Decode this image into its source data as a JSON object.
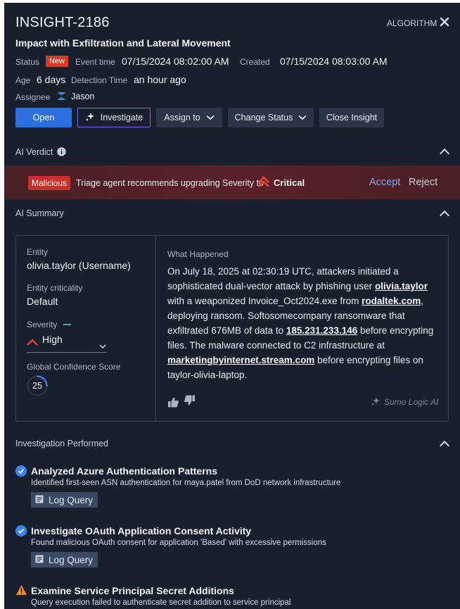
{
  "insight": {
    "id": "INSIGHT-2186",
    "source": "ALGORITHM",
    "title": "Impact with Exfiltration and Lateral Movement"
  },
  "meta": {
    "status_label": "Status",
    "status_value": "New",
    "event_time_label": "Event time",
    "event_time_value": "07/15/2024 08:02:00 AM",
    "created_label": "Created",
    "created_value": "07/15/2024 08:03:00 AM",
    "age_label": "Age",
    "age_value": "6 days",
    "detection_label": "Detection Time",
    "detection_value": "an hour ago",
    "assignee_label": "Assignee",
    "assignee_value": "Jason"
  },
  "actions": {
    "open": "Open",
    "investigate": "Investigate",
    "assign": "Assign to",
    "change_status": "Change Status",
    "close": "Close Insight"
  },
  "verdict": {
    "header": "AI Verdict",
    "badge": "Malicious",
    "text": "Triage agent recommends upgrading Severity to",
    "severity": "Critical",
    "accept": "Accept",
    "reject": "Reject",
    "colors": {
      "band": "#5a2228",
      "badge": "#c9302c",
      "severity": "#e8442f"
    }
  },
  "summary": {
    "header": "AI Summary",
    "entity_label": "Entity",
    "entity_value": "olivia.taylor (Username)",
    "criticality_label": "Entity criticality",
    "criticality_value": "Default",
    "severity_label": "Severity",
    "severity_value": "High",
    "confidence_label": "Global Confidence Score",
    "confidence_value": "25",
    "what_label": "What Happened",
    "what_parts": {
      "p1": "On July 18, 2025 at 02:30:19 UTC, attackers initiated a sophisticated dual-vector attack by phishing user",
      "user": "olivia.taylor",
      "p2": "with a weaponized Invoice_Oct2024.exe from",
      "domain1": "rodaltek.com",
      "p3": ", deploying ransom. Softosomecompany ransomware that exfiltrated 676MB of data to",
      "ip": "185.231.233.146",
      "p4": "before encrypting files. The malware connected to C2 infrastructure at",
      "domain2": "marketingbyinternet.stream.com",
      "p5": "before encrypting files on",
      "host": "taylor-olivia-laptop",
      "p6": "."
    },
    "ai_brand": "Sumo Logic AI"
  },
  "investigation": {
    "header": "Investigation Performed",
    "items": [
      {
        "title": "Analyzed Azure Authentication Patterns",
        "desc": "Identified first-seen ASN authentication for maya.patel from DoD network infrastructure",
        "button": "Log Query",
        "state": "success"
      },
      {
        "title": "Investigate OAuth Application Consent Activity",
        "desc": "Found malicious OAuth consent for application 'Based' with excessive permissions",
        "button": "Log Query",
        "state": "success"
      },
      {
        "title": "Examine Service Principal Secret Additions",
        "desc": "Query execution failed to authenticate secret addition to service principal",
        "state": "warning"
      }
    ]
  }
}
